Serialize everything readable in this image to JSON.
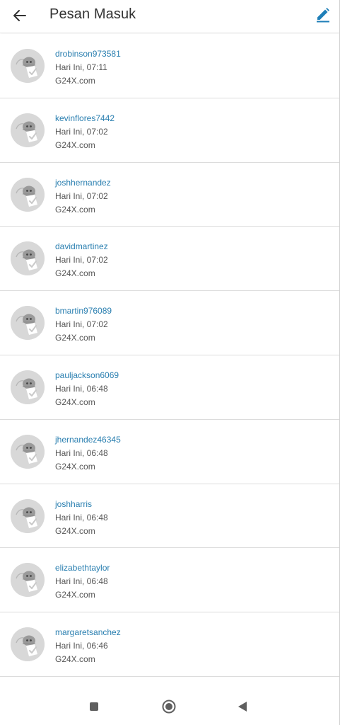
{
  "header": {
    "title": "Pesan Masuk",
    "back_icon": "arrow-left-icon",
    "compose_icon": "pencil-icon",
    "accent_color": "#1f7fb8"
  },
  "messages": [
    {
      "sender": "drobinson973581",
      "time": "Hari Ini, 07:11",
      "site": "G24X.com"
    },
    {
      "sender": "kevinflores7442",
      "time": "Hari Ini, 07:02",
      "site": "G24X.com"
    },
    {
      "sender": "joshhernandez",
      "time": "Hari Ini, 07:02",
      "site": "G24X.com"
    },
    {
      "sender": "davidmartinez",
      "time": "Hari Ini, 07:02",
      "site": "G24X.com"
    },
    {
      "sender": "bmartin976089",
      "time": "Hari Ini, 07:02",
      "site": "G24X.com"
    },
    {
      "sender": "pauljackson6069",
      "time": "Hari Ini, 06:48",
      "site": "G24X.com"
    },
    {
      "sender": "jhernandez46345",
      "time": "Hari Ini, 06:48",
      "site": "G24X.com"
    },
    {
      "sender": "joshharris",
      "time": "Hari Ini, 06:48",
      "site": "G24X.com"
    },
    {
      "sender": "elizabethtaylor",
      "time": "Hari Ini, 06:48",
      "site": "G24X.com"
    },
    {
      "sender": "margaretsanchez",
      "time": "Hari Ini, 06:46",
      "site": "G24X.com"
    }
  ],
  "navbar": {
    "recent_icon": "square-icon",
    "home_icon": "circle-home-icon",
    "back_icon": "triangle-back-icon"
  }
}
